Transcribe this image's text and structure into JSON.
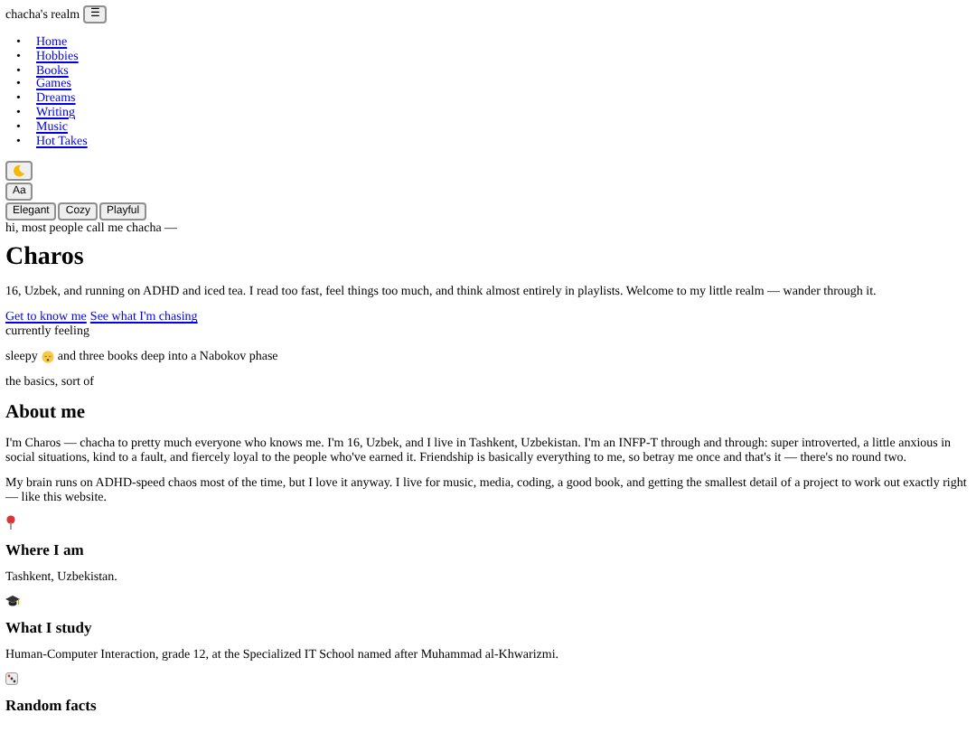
{
  "site_title": "chacha's realm",
  "menu_button": "☰",
  "nav_marker": "•",
  "nav": [
    "Home",
    "Hobbies",
    "Books",
    "Games",
    "Dreams",
    "Writing",
    "Music",
    "Hot Takes"
  ],
  "font_button": "Aa",
  "themes": [
    "Elegant",
    "Cozy",
    "Playful"
  ],
  "greeting": "hi, most people call me chacha —",
  "hero": {
    "title": "Charos",
    "intro": "16, Uzbek, and running on ADHD and iced tea. I read too fast, feel things too much, and think almost entirely in playlists. Welcome to my little realm — wander through it.",
    "links": [
      "Get to know me",
      "See what I'm chasing"
    ]
  },
  "mood": {
    "label": "currently feeling",
    "before": "sleepy",
    "after": "and three books deep into a Nabokov phase"
  },
  "basics_label": "the basics, sort of",
  "about": {
    "title": "About me",
    "paragraphs": [
      "I'm Charos — chacha to pretty much everyone who knows me. I'm 16, Uzbek, and I live in Tashkent, Uzbekistan. I'm an INFP-T through and through: super introverted, a little anxious in social situations, kind to a fault, and fiercely loyal to the people who've earned it. Friendship is basically everything to me, so betray me once and that's it — there's no round two.",
      "My brain runs on ADHD-speed chaos most of the time, but I love it anyway. I live for music, media, coding, a good book, and getting the smallest detail of a project to work out exactly right — like this website."
    ]
  },
  "facts": [
    {
      "kind": "pin",
      "title": "Where I am",
      "text": "Tashkent, Uzbekistan."
    },
    {
      "kind": "cap",
      "title": "What I study",
      "text": "Human-Computer Interaction, grade 12, at the Specialized IT School named after Muhammad al-Khwarizmi."
    },
    {
      "kind": "dice",
      "title": "Random facts"
    }
  ]
}
